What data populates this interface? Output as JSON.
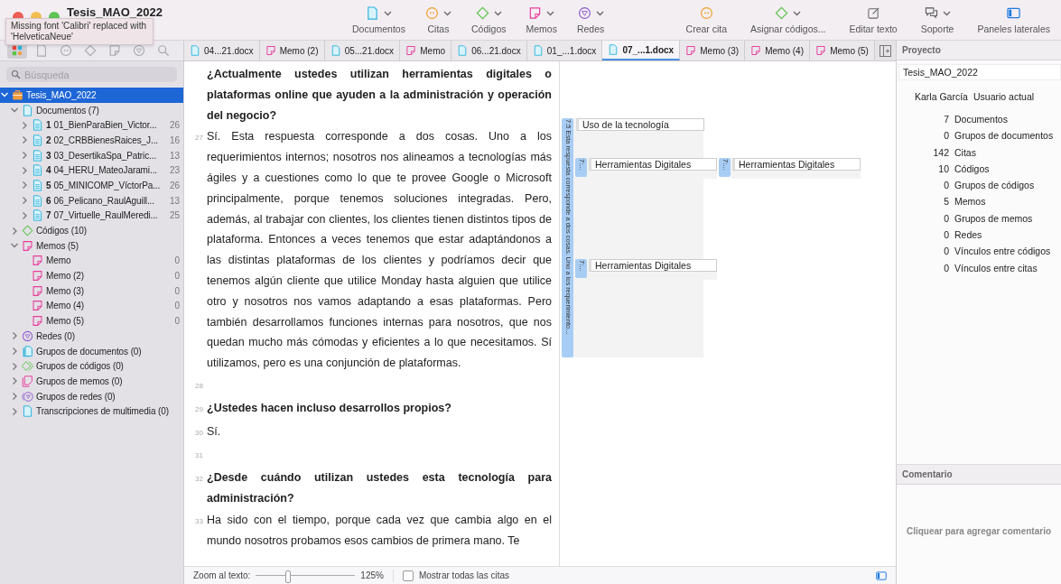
{
  "window": {
    "title": "Tesis_MAO_2022",
    "tooltip": "Missing font 'Calibri' replaced with 'HelveticaNeue'"
  },
  "toolbar": {
    "groups": [
      {
        "kind": "document",
        "label": "Documentos",
        "menu": true
      },
      {
        "kind": "quote",
        "label": "Citas",
        "menu": true
      },
      {
        "kind": "code",
        "label": "Códigos",
        "menu": true
      },
      {
        "kind": "memo",
        "label": "Memos",
        "menu": true
      },
      {
        "kind": "network",
        "label": "Redes",
        "menu": true
      }
    ],
    "actions": [
      {
        "kind": "quote",
        "label": "Crear cita",
        "menu": false
      },
      {
        "kind": "code",
        "label": "Asignar códigos...",
        "menu": true
      },
      {
        "kind": "edit",
        "label": "Editar texto",
        "menu": false
      },
      {
        "kind": "support",
        "label": "Soporte",
        "menu": true
      },
      {
        "kind": "panels",
        "label": "Paneles laterales",
        "menu": false
      }
    ]
  },
  "sidebar": {
    "tabs": [
      {
        "kind": "home",
        "selected": true
      },
      {
        "kind": "document",
        "selected": false
      },
      {
        "kind": "quote",
        "selected": false
      },
      {
        "kind": "code",
        "selected": false
      },
      {
        "kind": "memo",
        "selected": false
      },
      {
        "kind": "network",
        "selected": false
      },
      {
        "kind": "search",
        "selected": false
      }
    ],
    "search": {
      "placeholder": "Búsqueda"
    },
    "tree": [
      {
        "kind": "project",
        "label": "Tesis_MAO_2022",
        "expanded": true,
        "selected": true,
        "children": [
          {
            "kind": "document",
            "label": "Documentos (7)",
            "expanded": true,
            "selected": false,
            "children": [
              {
                "kind": "doc",
                "number": "1",
                "label": "01_BienParaBien_Victor...",
                "count": "26",
                "expanded": false,
                "selected": false
              },
              {
                "kind": "doc",
                "number": "2",
                "label": "02_CRBBienesRaices_J...",
                "count": "16",
                "expanded": false,
                "selected": false
              },
              {
                "kind": "doc",
                "number": "3",
                "label": "03_DesertikaSpa_Patric...",
                "count": "13",
                "expanded": false,
                "selected": false
              },
              {
                "kind": "doc",
                "number": "4",
                "label": "04_HERU_MateoJarami...",
                "count": "23",
                "expanded": false,
                "selected": false
              },
              {
                "kind": "doc",
                "number": "5",
                "label": "05_MINICOMP_VíctorPa...",
                "count": "26",
                "expanded": false,
                "selected": false
              },
              {
                "kind": "doc",
                "number": "6",
                "label": "06_Pelicano_RaulAguill...",
                "count": "13",
                "expanded": false,
                "selected": false
              },
              {
                "kind": "doc",
                "number": "7",
                "label": "07_Virtuelle_RaulMeredi...",
                "count": "25",
                "expanded": false,
                "selected": false
              }
            ]
          },
          {
            "kind": "code",
            "label": "Códigos (10)",
            "expanded": false,
            "selected": false
          },
          {
            "kind": "memo",
            "label": "Memos (5)",
            "expanded": true,
            "selected": false,
            "children": [
              {
                "kind": "memoleaf",
                "label": "Memo",
                "count": "0",
                "selected": false
              },
              {
                "kind": "memoleaf",
                "label": "Memo (2)",
                "count": "0",
                "selected": false
              },
              {
                "kind": "memoleaf",
                "label": "Memo (3)",
                "count": "0",
                "selected": false
              },
              {
                "kind": "memoleaf",
                "label": "Memo (4)",
                "count": "0",
                "selected": false
              },
              {
                "kind": "memoleaf",
                "label": "Memo (5)",
                "count": "0",
                "selected": false
              }
            ]
          },
          {
            "kind": "network",
            "label": "Redes (0)",
            "expanded": false,
            "selected": false
          },
          {
            "kind": "docgroup",
            "label": "Grupos de documentos (0)",
            "expanded": false,
            "selected": false
          },
          {
            "kind": "codegroup",
            "label": "Grupos de códigos (0)",
            "expanded": false,
            "selected": false
          },
          {
            "kind": "memogroup",
            "label": "Grupos de memos (0)",
            "expanded": false,
            "selected": false
          },
          {
            "kind": "netgroup",
            "label": "Grupos de redes (0)",
            "expanded": false,
            "selected": false
          },
          {
            "kind": "media",
            "label": "Transcripciones de multimedia (0)",
            "expanded": false,
            "selected": false
          }
        ]
      }
    ]
  },
  "tabs": [
    {
      "kind": "document",
      "label": "04...21.docx",
      "selected": false
    },
    {
      "kind": "memo",
      "label": "Memo (2)",
      "selected": false
    },
    {
      "kind": "document",
      "label": "05...21.docx",
      "selected": false
    },
    {
      "kind": "memo",
      "label": "Memo",
      "selected": false
    },
    {
      "kind": "document",
      "label": "06...21.docx",
      "selected": false
    },
    {
      "kind": "document",
      "label": "01_...1.docx",
      "selected": false
    },
    {
      "kind": "document",
      "label": "07_...1.docx",
      "selected": true
    },
    {
      "kind": "memo",
      "label": "Memo (3)",
      "selected": false
    },
    {
      "kind": "memo",
      "label": "Memo (4)",
      "selected": false
    },
    {
      "kind": "memo",
      "label": "Memo (5)",
      "selected": false
    }
  ],
  "document": {
    "paragraphs": [
      {
        "kind": "question",
        "text": "¿Actualmente ustedes utilizan herramientas digitales o plataformas online que ayuden a la administración y operación del negocio?"
      },
      {
        "kind": "answer",
        "number": "27",
        "text": "Sí. Esta respuesta corresponde a dos cosas. Uno a los requerimientos internos; nosotros nos alineamos a tecnologías más ágiles y a cuestiones como lo que te provee Google o Microsoft principalmente, porque tenemos soluciones integradas. Pero, además, al trabajar con clientes, los clientes tienen distintos tipos de plataforma. Entonces a veces tenemos que estar adaptándonos a las distintas plataformas de los clientes y podríamos decir que tenemos algún cliente que utilice Monday hasta alguien que utilice otro y nosotros nos vamos adaptando a esas plataformas. Pero también desarrollamos funciones internas para nosotros, que nos quedan mucho más cómodas y eficientes a lo que necesitamos. Sí utilizamos, pero es una conjunción de plataformas."
      },
      {
        "kind": "blank",
        "number": "28"
      },
      {
        "kind": "question",
        "number": "29",
        "text": "¿Ustedes hacen incluso desarrollos propios?"
      },
      {
        "kind": "answer",
        "number": "30",
        "text": "Sí."
      },
      {
        "kind": "blank",
        "number": "31"
      },
      {
        "kind": "question",
        "number": "32",
        "text": "¿Desde cuándo utilizan ustedes esta tecnología para administración?"
      },
      {
        "kind": "answer",
        "number": "33",
        "text": "Ha sido con el tiempo, porque cada vez que cambia algo en el mundo nosotros probamos esos cambios de primera mano. Te"
      }
    ]
  },
  "margin": {
    "quotations": [
      {
        "label": "7:5 Esta respuesta corresponde a dos cosas. Uno a los requerimiento...",
        "code": "Uso de la tecnología"
      },
      {
        "label": "7:...",
        "code": "Herramientas Digitales"
      },
      {
        "label": "7:...",
        "code": "Herramientas Digitales"
      },
      {
        "label": "7:...",
        "code": "Herramientas Digitales"
      }
    ]
  },
  "status_bar": {
    "zoom_label": "Zoom al texto:",
    "level": 0.3,
    "zoom_value": "125%",
    "show_all": {
      "label": "Mostrar todas las citas",
      "checked": false
    }
  },
  "project_panel": {
    "title": "Proyecto",
    "name": "Tesis_MAO_2022",
    "user": "Karla García",
    "user_label": "Usuario actual",
    "stats": [
      {
        "count": "7",
        "label": "Documentos"
      },
      {
        "count": "0",
        "label": "Grupos de documentos"
      },
      {
        "count": "142",
        "label": "Citas"
      },
      {
        "count": "10",
        "label": "Códigos"
      },
      {
        "count": "0",
        "label": "Grupos de códigos"
      },
      {
        "count": "5",
        "label": "Memos"
      },
      {
        "count": "0",
        "label": "Grupos de memos"
      },
      {
        "count": "0",
        "label": "Redes"
      },
      {
        "count": "0",
        "label": "Vínculos entre códigos"
      },
      {
        "count": "0",
        "label": "Vínculos entre citas"
      }
    ]
  },
  "comment_panel": {
    "title": "Comentario",
    "placeholder": "Cliquear para agregar comentario"
  }
}
